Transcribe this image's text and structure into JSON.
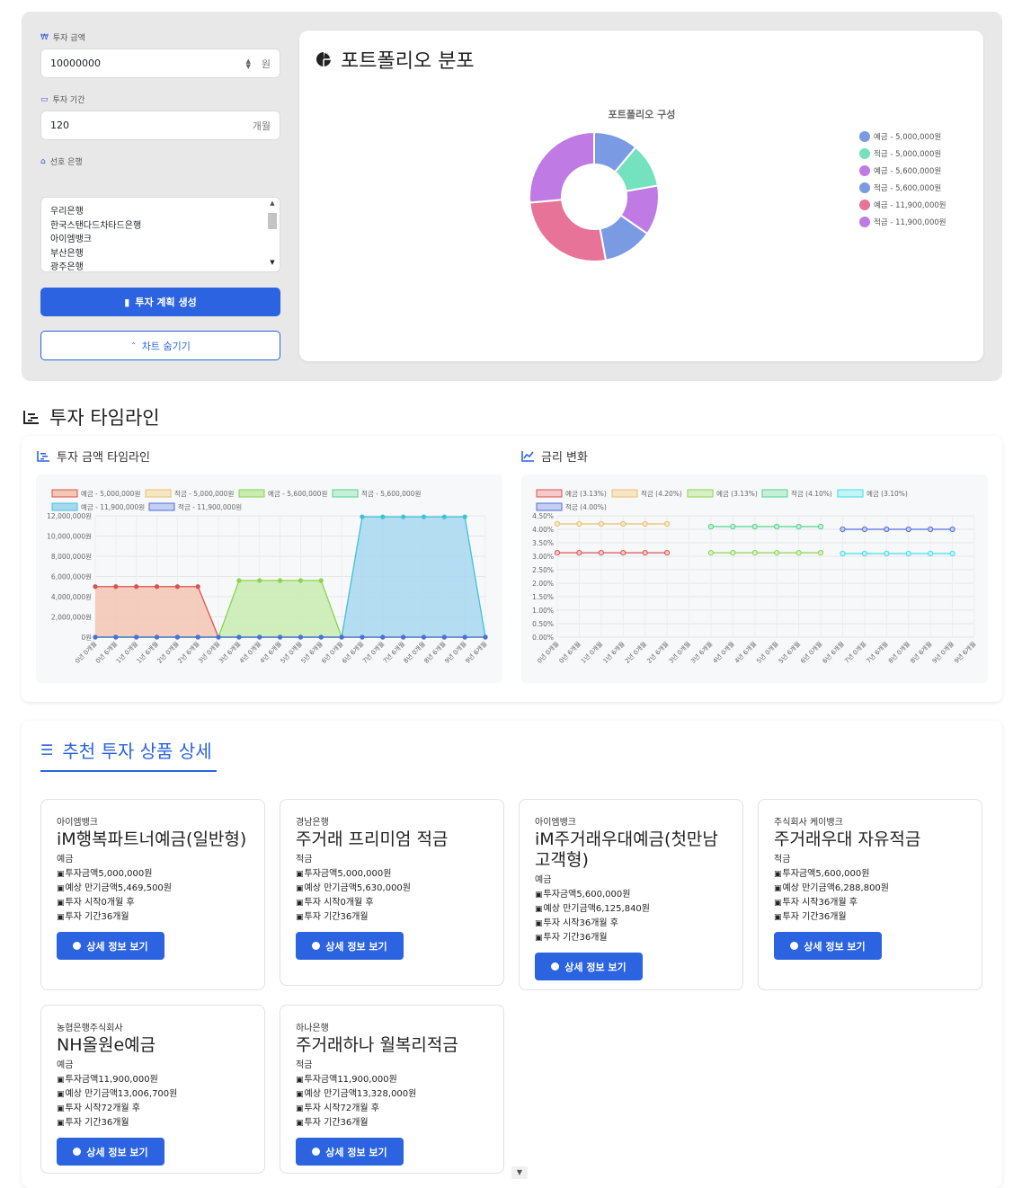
{
  "form": {
    "amount_label": "투자 금액",
    "amount_value": "10000000",
    "amount_suffix": "원",
    "period_label": "투자 기간",
    "period_value": "120",
    "period_suffix": "개월",
    "bank_label": "선호 은행",
    "banks": [
      "우리은행",
      "한국스탠다드차타드은행",
      "아이엠뱅크",
      "부산은행",
      "광주은행"
    ],
    "generate_button": "투자 계획 생성",
    "hide_chart_button": "차트 숨기기"
  },
  "pie_card": {
    "title": "포트폴리오 분포",
    "chart_title": "포트폴리오 구성"
  },
  "timeline": {
    "section_title": "투자 타임라인",
    "amount_chart_title": "투자 금액 타임라인",
    "rate_chart_title": "금리 변화"
  },
  "colors": {
    "primary": "#2b63e0"
  },
  "chart_data": [
    {
      "type": "pie",
      "title": "포트폴리오 구성",
      "legend_position": "right",
      "labels": [
        "예금 - 5,000,000원",
        "적금 - 5,000,000원",
        "예금 - 5,600,000원",
        "적금 - 5,600,000원",
        "예금 - 11,900,000원",
        "적금 - 11,900,000원"
      ],
      "values": [
        5000000,
        5000000,
        5600000,
        5600000,
        11900000,
        11900000
      ],
      "colors": [
        "#7a9be4",
        "#74e2be",
        "#c07ae4",
        "#7a9be4",
        "#e77498",
        "#c07ae4"
      ]
    },
    {
      "type": "area",
      "x": [
        "0년 0개월",
        "0년 6개월",
        "1년 0개월",
        "1년 6개월",
        "2년 0개월",
        "2년 6개월",
        "3년 0개월",
        "3년 6개월",
        "4년 0개월",
        "4년 6개월",
        "5년 0개월",
        "5년 6개월",
        "6년 0개월",
        "6년 6개월",
        "7년 0개월",
        "7년 6개월",
        "8년 0개월",
        "8년 6개월",
        "9년 0개월",
        "9년 6개월"
      ],
      "ylim": [
        0,
        12000000
      ],
      "yticks": [
        "0원",
        "2,000,000원",
        "4,000,000원",
        "6,000,000원",
        "8,000,000원",
        "10,000,000원",
        "12,000,000원"
      ],
      "legend_position": "top",
      "series": [
        {
          "name": "예금 - 5,000,000원",
          "color": "#d9534f",
          "fill": "#f4c6b4",
          "values": [
            5000000,
            5000000,
            5000000,
            5000000,
            5000000,
            5000000,
            0,
            0,
            0,
            0,
            0,
            0,
            0,
            0,
            0,
            0,
            0,
            0,
            0,
            0
          ]
        },
        {
          "name": "적금 - 5,000,000원",
          "color": "#e8c06a",
          "fill": "#f6e6c4",
          "values": [
            0,
            0,
            0,
            0,
            0,
            0,
            0,
            0,
            0,
            0,
            0,
            0,
            0,
            0,
            0,
            0,
            0,
            0,
            0,
            0
          ]
        },
        {
          "name": "예금 - 5,600,000원",
          "color": "#8bd44e",
          "fill": "#c9ecb0",
          "values": [
            0,
            0,
            0,
            0,
            0,
            0,
            0,
            5600000,
            5600000,
            5600000,
            5600000,
            5600000,
            0,
            0,
            0,
            0,
            0,
            0,
            0,
            0
          ]
        },
        {
          "name": "적금 - 5,600,000원",
          "color": "#4fd488",
          "fill": "#c6f0d8",
          "values": [
            0,
            0,
            0,
            0,
            0,
            0,
            0,
            0,
            0,
            0,
            0,
            0,
            0,
            0,
            0,
            0,
            0,
            0,
            0,
            0
          ]
        },
        {
          "name": "예금 - 11,900,000원",
          "color": "#3cc3d8",
          "fill": "#a8d8ee",
          "values": [
            0,
            0,
            0,
            0,
            0,
            0,
            0,
            0,
            0,
            0,
            0,
            0,
            0,
            11900000,
            11900000,
            11900000,
            11900000,
            11900000,
            11900000,
            0
          ]
        },
        {
          "name": "적금 - 11,900,000원",
          "color": "#4f6ed8",
          "fill": "#c4cff2",
          "values": [
            0,
            0,
            0,
            0,
            0,
            0,
            0,
            0,
            0,
            0,
            0,
            0,
            0,
            0,
            0,
            0,
            0,
            0,
            0,
            0
          ]
        }
      ]
    },
    {
      "type": "line",
      "x": [
        "0년 0개월",
        "0년 6개월",
        "1년 0개월",
        "1년 6개월",
        "2년 0개월",
        "2년 6개월",
        "3년 0개월",
        "3년 6개월",
        "4년 0개월",
        "4년 6개월",
        "5년 0개월",
        "5년 6개월",
        "6년 0개월",
        "6년 6개월",
        "7년 0개월",
        "7년 6개월",
        "8년 0개월",
        "8년 6개월",
        "9년 0개월",
        "9년 6개월"
      ],
      "ylim": [
        0,
        4.5
      ],
      "yticks": [
        "0.00%",
        "0.50%",
        "1.00%",
        "1.50%",
        "2.00%",
        "2.50%",
        "3.00%",
        "3.50%",
        "4.00%",
        "4.50%"
      ],
      "legend_position": "top",
      "series": [
        {
          "name": "예금 (3.13%)",
          "color": "#d9534f",
          "fill": "#f6c8c8",
          "values": [
            3.13,
            3.13,
            3.13,
            3.13,
            3.13,
            3.13,
            null,
            null,
            null,
            null,
            null,
            null,
            null,
            null,
            null,
            null,
            null,
            null,
            null,
            null
          ]
        },
        {
          "name": "적금 (4.20%)",
          "color": "#e8c06a",
          "fill": "#f6e6c4",
          "values": [
            4.2,
            4.2,
            4.2,
            4.2,
            4.2,
            4.2,
            null,
            null,
            null,
            null,
            null,
            null,
            null,
            null,
            null,
            null,
            null,
            null,
            null,
            null
          ]
        },
        {
          "name": "예금 (3.13%)",
          "color": "#8bd44e",
          "fill": "#d6f0c4",
          "values": [
            null,
            null,
            null,
            null,
            null,
            null,
            null,
            3.13,
            3.13,
            3.13,
            3.13,
            3.13,
            3.13,
            null,
            null,
            null,
            null,
            null,
            null,
            null
          ]
        },
        {
          "name": "적금 (4.10%)",
          "color": "#4fd488",
          "fill": "#c6f0d8",
          "values": [
            null,
            null,
            null,
            null,
            null,
            null,
            null,
            4.1,
            4.1,
            4.1,
            4.1,
            4.1,
            4.1,
            null,
            null,
            null,
            null,
            null,
            null,
            null
          ]
        },
        {
          "name": "예금 (3.10%)",
          "color": "#3ce0e8",
          "fill": "#c6f4f6",
          "values": [
            null,
            null,
            null,
            null,
            null,
            null,
            null,
            null,
            null,
            null,
            null,
            null,
            null,
            3.1,
            3.1,
            3.1,
            3.1,
            3.1,
            3.1,
            null
          ]
        },
        {
          "name": "적금 (4.00%)",
          "color": "#4f6ed8",
          "fill": "#c4cff2",
          "values": [
            null,
            null,
            null,
            null,
            null,
            null,
            null,
            null,
            null,
            null,
            null,
            null,
            null,
            4.0,
            4.0,
            4.0,
            4.0,
            4.0,
            4.0,
            null
          ]
        }
      ]
    }
  ],
  "products": {
    "section_title": "추천 투자 상품 상세",
    "detail_button": "상세 정보 보기",
    "items": [
      {
        "bank": "아이엠뱅크",
        "name": "iM행복파트너예금(일반형)",
        "type": "예금",
        "amount": "투자금액5,000,000원",
        "maturity": "예상 만기금액5,469,500원",
        "start": "투자 시작0개월 후",
        "period": "투자 기간36개월"
      },
      {
        "bank": "경남은행",
        "name": "주거래 프리미엄 적금",
        "type": "적금",
        "amount": "투자금액5,000,000원",
        "maturity": "예상 만기금액5,630,000원",
        "start": "투자 시작0개월 후",
        "period": "투자 기간36개월"
      },
      {
        "bank": "아이엠뱅크",
        "name": "iM주거래우대예금(첫만남고객형)",
        "type": "예금",
        "amount": "투자금액5,600,000원",
        "maturity": "예상 만기금액6,125,840원",
        "start": "투자 시작36개월 후",
        "period": "투자 기간36개월"
      },
      {
        "bank": "주식회사 케이뱅크",
        "name": "주거래우대 자유적금",
        "type": "적금",
        "amount": "투자금액5,600,000원",
        "maturity": "예상 만기금액6,288,800원",
        "start": "투자 시작36개월 후",
        "period": "투자 기간36개월"
      },
      {
        "bank": "농협은행주식회사",
        "name": "NH올원e예금",
        "type": "예금",
        "amount": "투자금액11,900,000원",
        "maturity": "예상 만기금액13,006,700원",
        "start": "투자 시작72개월 후",
        "period": "투자 기간36개월"
      },
      {
        "bank": "하나은행",
        "name": "주거래하나 월복리적금",
        "type": "적금",
        "amount": "투자금액11,900,000원",
        "maturity": "예상 만기금액13,328,000원",
        "start": "투자 시작72개월 후",
        "period": "투자 기간36개월"
      }
    ]
  }
}
